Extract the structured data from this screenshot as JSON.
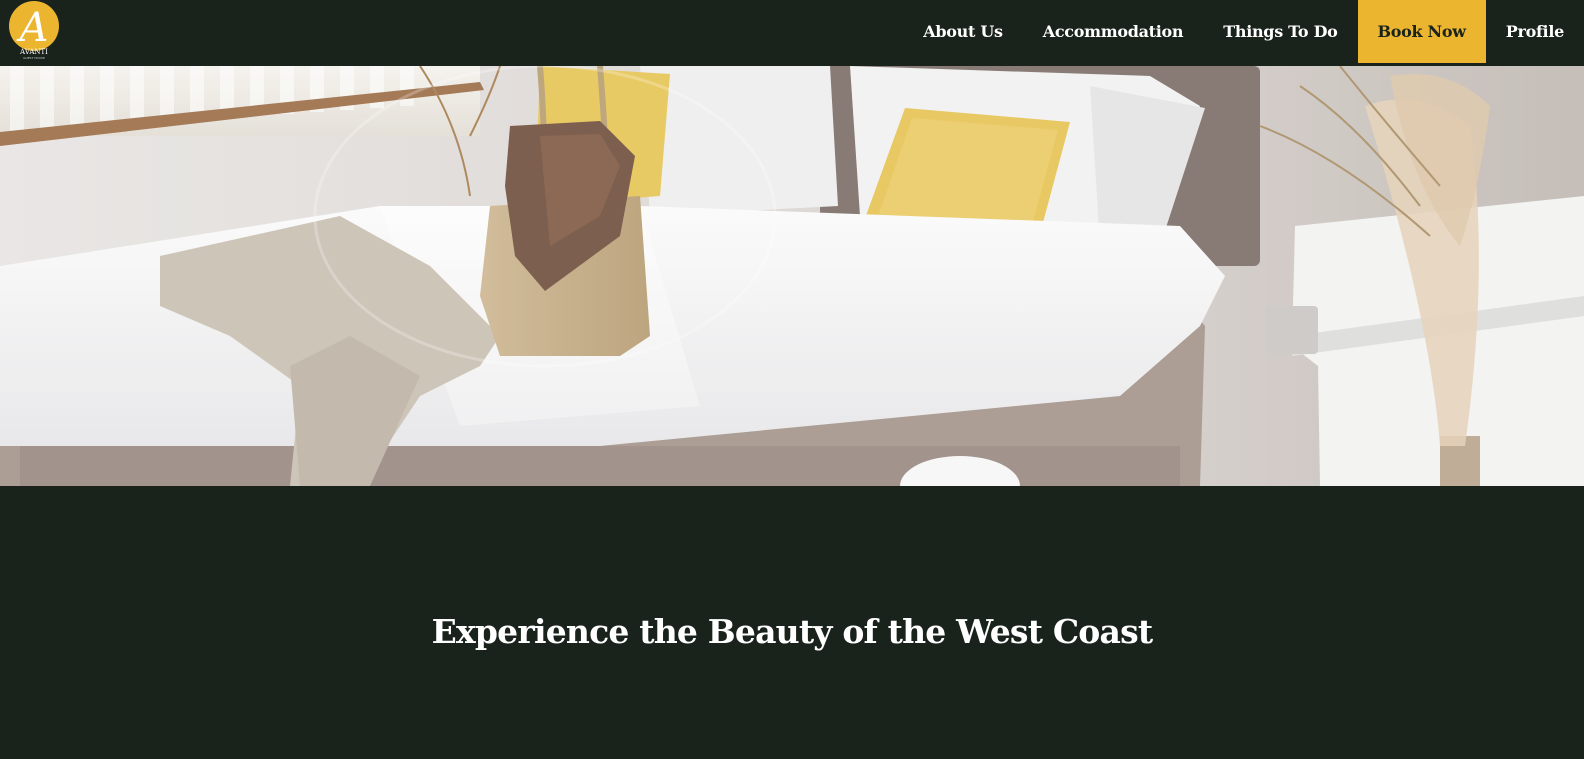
{
  "brand": {
    "logo_letter": "A",
    "logo_name": "AVANTI",
    "logo_sub": "GUEST HOUSE",
    "logo_color": "#ecb52f"
  },
  "nav": {
    "items": [
      {
        "label": "About Us"
      },
      {
        "label": "Accommodation"
      },
      {
        "label": "Things To Do"
      },
      {
        "label": "Book Now"
      },
      {
        "label": "Profile"
      }
    ]
  },
  "hero": {
    "image": "bedroom-photo"
  },
  "main": {
    "headline": "Experience the Beauty of the West Coast"
  },
  "colors": {
    "background": "#1a231b",
    "accent": "#ecb52f",
    "text": "#ffffff"
  }
}
